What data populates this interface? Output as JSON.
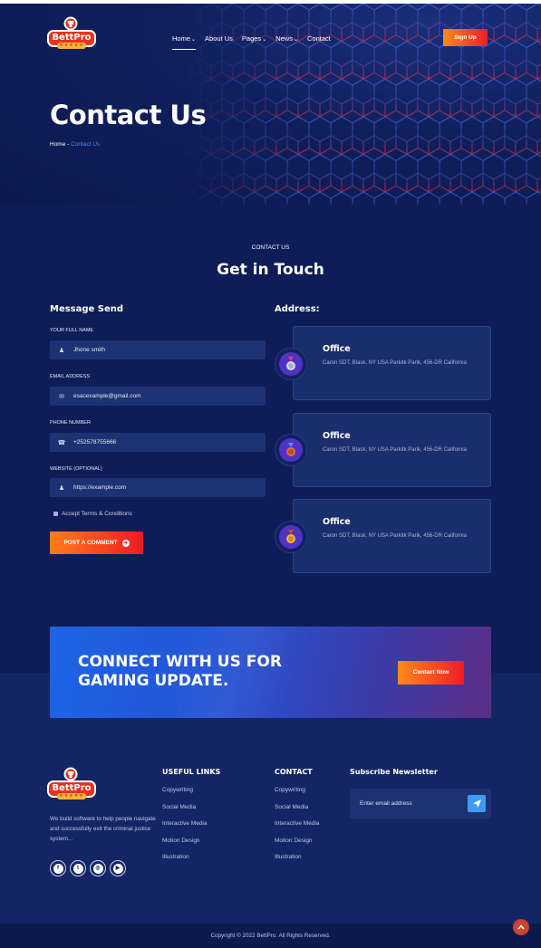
{
  "brand": {
    "name": "BettPro",
    "stars": "★★★★★"
  },
  "nav": {
    "items": [
      {
        "label": "Home",
        "caret": "⌄"
      },
      {
        "label": "About Us",
        "caret": ""
      },
      {
        "label": "Pages",
        "caret": "⌄"
      },
      {
        "label": "News",
        "caret": "⌄"
      },
      {
        "label": "Contact",
        "caret": ""
      }
    ],
    "signup": "Sign Up"
  },
  "hero": {
    "title": "Contact Us",
    "breadcrumb_home": "Home",
    "breadcrumb_sep": " - ",
    "breadcrumb_current": "Contact Us"
  },
  "contact": {
    "eyebrow": "CONTACT US",
    "title": "Get in Touch",
    "form_title": "Message Send",
    "fields": [
      {
        "label": "YOUR FULL NAME",
        "value": "Jhone smith",
        "icon": "user-icon"
      },
      {
        "label": "EMAIL ADDRESS",
        "value": "esacexample@gmail.com",
        "icon": "mail-icon"
      },
      {
        "label": "PHONE NUMBER",
        "value": "+252578755666",
        "icon": "phone-icon"
      },
      {
        "label": "WEBSITE (OPTIONAL)",
        "value": "https://example.com",
        "icon": "user-icon"
      }
    ],
    "terms": "Accept Terms & Conditions",
    "submit": "POST A COMMENT",
    "address_title": "Address:",
    "offices": [
      {
        "title": "Office",
        "address": "Caron SDT, Blask, NY USA Parkitk Parik, 456-DR California",
        "icon": "silver-medal-icon"
      },
      {
        "title": "Office",
        "address": "Caron SDT, Blask, NY USA Parkitk Parik, 456-DR California",
        "icon": "bronze-medal-icon"
      },
      {
        "title": "Office",
        "address": "Caron SDT, Blask, NY USA Parkitk Parik, 456-DR California",
        "icon": "gold-medal-icon"
      }
    ]
  },
  "cta": {
    "line1": "CONNECT WITH US FOR",
    "line2": "GAMING UPDATE.",
    "button": "Contact Now"
  },
  "footer": {
    "about": "We build software to help people navigate and successfully exit the criminal justice system...",
    "socials": [
      "f",
      "t",
      "◎",
      "▶"
    ],
    "useful": {
      "title": "USEFUL LINKS",
      "links": [
        "Copywriting",
        "Social Media",
        "Interactive Media",
        "Motion Design",
        "Illustration"
      ]
    },
    "contact": {
      "title": "CONTACT",
      "links": [
        "Copywriting",
        "Social Media",
        "Interactive Media",
        "Motion Design",
        "Illustration"
      ]
    },
    "newsletter": {
      "title": "Subscribe Newsletter",
      "placeholder": "Enter email address"
    },
    "copyright": "Copyright © 2022 BettPro. All Rights Reserved."
  },
  "colors": {
    "bg": "#0e1d57",
    "accent_orange": "#ff8a1a",
    "accent_red": "#ee1c24",
    "link_blue": "#3e95ff"
  }
}
